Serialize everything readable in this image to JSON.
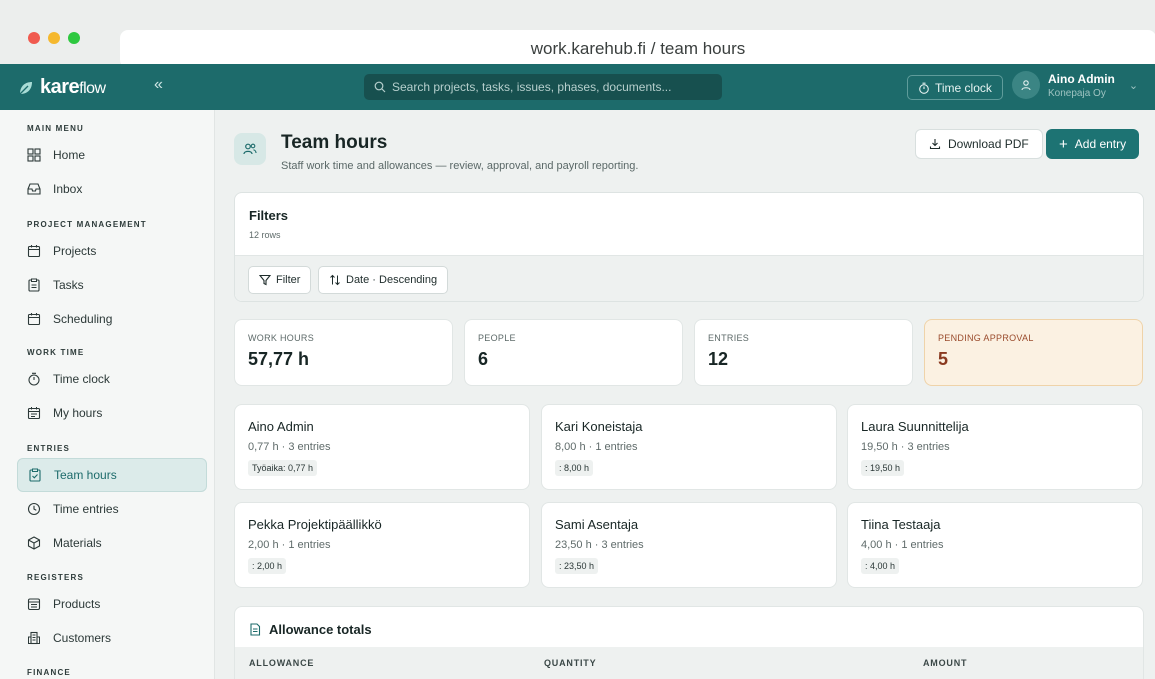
{
  "browser": {
    "url": "work.karehub.fi / team hours"
  },
  "appbar": {
    "logo_main": "kare",
    "logo_sub": "flow",
    "collapse": "«",
    "search_placeholder": "Search projects, tasks, issues, phases, documents...",
    "timeclock_label": "Time clock",
    "user_name": "Aino Admin",
    "user_org": "Konepaja Oy"
  },
  "sidebar": {
    "sections": [
      {
        "title": "MAIN MENU",
        "items": [
          {
            "label": "Home",
            "icon": "grid-icon"
          },
          {
            "label": "Inbox",
            "icon": "inbox-icon"
          }
        ]
      },
      {
        "title": "PROJECT MANAGEMENT",
        "items": [
          {
            "label": "Projects",
            "icon": "calendar-icon"
          },
          {
            "label": "Tasks",
            "icon": "clipboard-icon"
          },
          {
            "label": "Scheduling",
            "icon": "calendar-icon"
          }
        ]
      },
      {
        "title": "WORK TIME",
        "items": [
          {
            "label": "Time clock",
            "icon": "stopwatch-icon"
          },
          {
            "label": "My hours",
            "icon": "calendar-icon"
          }
        ]
      },
      {
        "title": "ENTRIES",
        "items": [
          {
            "label": "Team hours",
            "icon": "clipboard-check-icon",
            "active": true
          },
          {
            "label": "Time entries",
            "icon": "clock-icon"
          },
          {
            "label": "Materials",
            "icon": "box-icon"
          }
        ]
      },
      {
        "title": "REGISTERS",
        "items": [
          {
            "label": "Products",
            "icon": "archive-icon"
          },
          {
            "label": "Customers",
            "icon": "building-icon"
          }
        ]
      },
      {
        "title": "FINANCE",
        "items": []
      }
    ]
  },
  "page": {
    "title": "Team hours",
    "subtitle": "Staff work time and allowances — review, approval, and payroll reporting.",
    "download_label": "Download PDF",
    "add_label": "Add entry"
  },
  "filters": {
    "title": "Filters",
    "rows": "12 rows",
    "filter_label": "Filter",
    "sort_label": "Date · Descending"
  },
  "stats": [
    {
      "label": "WORK HOURS",
      "value": "57,77 h"
    },
    {
      "label": "PEOPLE",
      "value": "6"
    },
    {
      "label": "ENTRIES",
      "value": "12"
    },
    {
      "label": "PENDING APPROVAL",
      "value": "5"
    }
  ],
  "people": [
    {
      "name": "Aino Admin",
      "meta": "0,77 h · 3 entries",
      "tag": "Työaika: 0,77 h"
    },
    {
      "name": "Kari Koneistaja",
      "meta": "8,00 h · 1 entries",
      "tag": ": 8,00 h"
    },
    {
      "name": "Laura Suunnittelija",
      "meta": "19,50 h · 3 entries",
      "tag": ": 19,50 h"
    },
    {
      "name": "Pekka Projektipäällikkö",
      "meta": "2,00 h · 1 entries",
      "tag": ": 2,00 h"
    },
    {
      "name": "Sami Asentaja",
      "meta": "23,50 h · 3 entries",
      "tag": ": 23,50 h"
    },
    {
      "name": "Tiina Testaaja",
      "meta": "4,00 h · 1 entries",
      "tag": ": 4,00 h"
    }
  ],
  "allowances": {
    "title": "Allowance totals",
    "columns": [
      "ALLOWANCE",
      "QUANTITY",
      "AMOUNT"
    ]
  }
}
